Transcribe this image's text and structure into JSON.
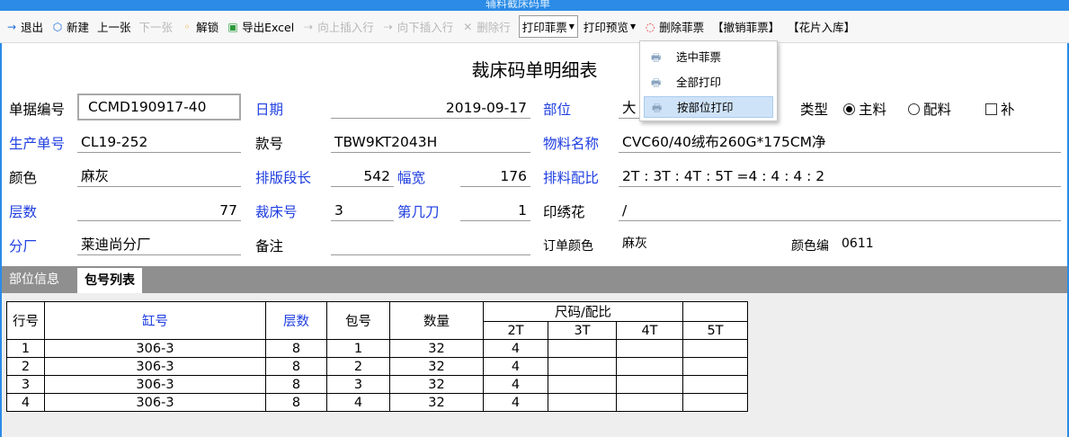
{
  "window": {
    "title": "辅料截床码单"
  },
  "toolbar": {
    "exit": "退出",
    "new": "新建",
    "prev": "上一张",
    "next": "下一张",
    "unlock": "解锁",
    "export": "导出Excel",
    "insert_up": "向上插入行",
    "insert_down": "向下插入行",
    "delete_row": "删除行",
    "print_ticket": "打印菲票",
    "print_preview": "打印预览",
    "delete_ticket": "删除菲票",
    "cancel_ticket": "【撤销菲票】",
    "pattern_store": "【花片入库】"
  },
  "print_menu": {
    "items": [
      "选中菲票",
      "全部打印",
      "按部位打印"
    ]
  },
  "form": {
    "title": "裁床码单明细表",
    "doc_no_label": "单据编号",
    "doc_no": "CCMD190917-40",
    "date_label": "日期",
    "date": "2019-09-17",
    "dept_label": "部位",
    "dept": "大",
    "type_label": "类型",
    "type_main": "主料",
    "type_aux": "配料",
    "type_supp": "补",
    "prod_no_label": "生产单号",
    "prod_no": "CL19-252",
    "style_label": "款号",
    "style": "TBW9KT2043H",
    "material_label": "物料名称",
    "material": "CVC60/40绒布260G*175CM净",
    "color_label": "颜色",
    "color": "麻灰",
    "seg_len_label": "排版段长",
    "seg_len": "542",
    "width_label": "幅宽",
    "width": "176",
    "ratio_label": "排料配比",
    "ratio": "2T : 3T : 4T : 5T =4 : 4 : 4 : 2",
    "layers_label": "层数",
    "layers": "77",
    "bed_no_label": "裁床号",
    "bed_no": "3",
    "knife_label": "第几刀",
    "knife": "1",
    "print_emb_label": "印绣花",
    "print_emb": "/",
    "factory_label": "分厂",
    "factory": "莱迪尚分厂",
    "remark_label": "备注",
    "remark": "",
    "order_color_label": "订单颜色",
    "order_color": "麻灰",
    "color_code_label": "颜色编",
    "color_code": "0611"
  },
  "tabs": [
    "部位信息",
    "包号列表"
  ],
  "grid": {
    "headers": {
      "row": "行号",
      "vat": "缸号",
      "layers": "层数",
      "pack": "包号",
      "qty": "数量",
      "size_ratio": "尺码/配比"
    },
    "sizes": [
      "2T",
      "3T",
      "4T",
      "5T"
    ],
    "rows": [
      {
        "row": "1",
        "vat": "306-3",
        "layers": "8",
        "pack": "1",
        "qty": "32",
        "s2T": "4",
        "s3T": "",
        "s4T": "",
        "s5T": ""
      },
      {
        "row": "2",
        "vat": "306-3",
        "layers": "8",
        "pack": "2",
        "qty": "32",
        "s2T": "4",
        "s3T": "",
        "s4T": "",
        "s5T": ""
      },
      {
        "row": "3",
        "vat": "306-3",
        "layers": "8",
        "pack": "3",
        "qty": "32",
        "s2T": "4",
        "s3T": "",
        "s4T": "",
        "s5T": ""
      },
      {
        "row": "4",
        "vat": "306-3",
        "layers": "8",
        "pack": "4",
        "qty": "32",
        "s2T": "4",
        "s3T": "",
        "s4T": "",
        "s5T": ""
      }
    ]
  },
  "colors": {
    "accent": "#2b8be6",
    "label_blue": "#1f3ee0",
    "tab_bar": "#8f8f8f"
  }
}
